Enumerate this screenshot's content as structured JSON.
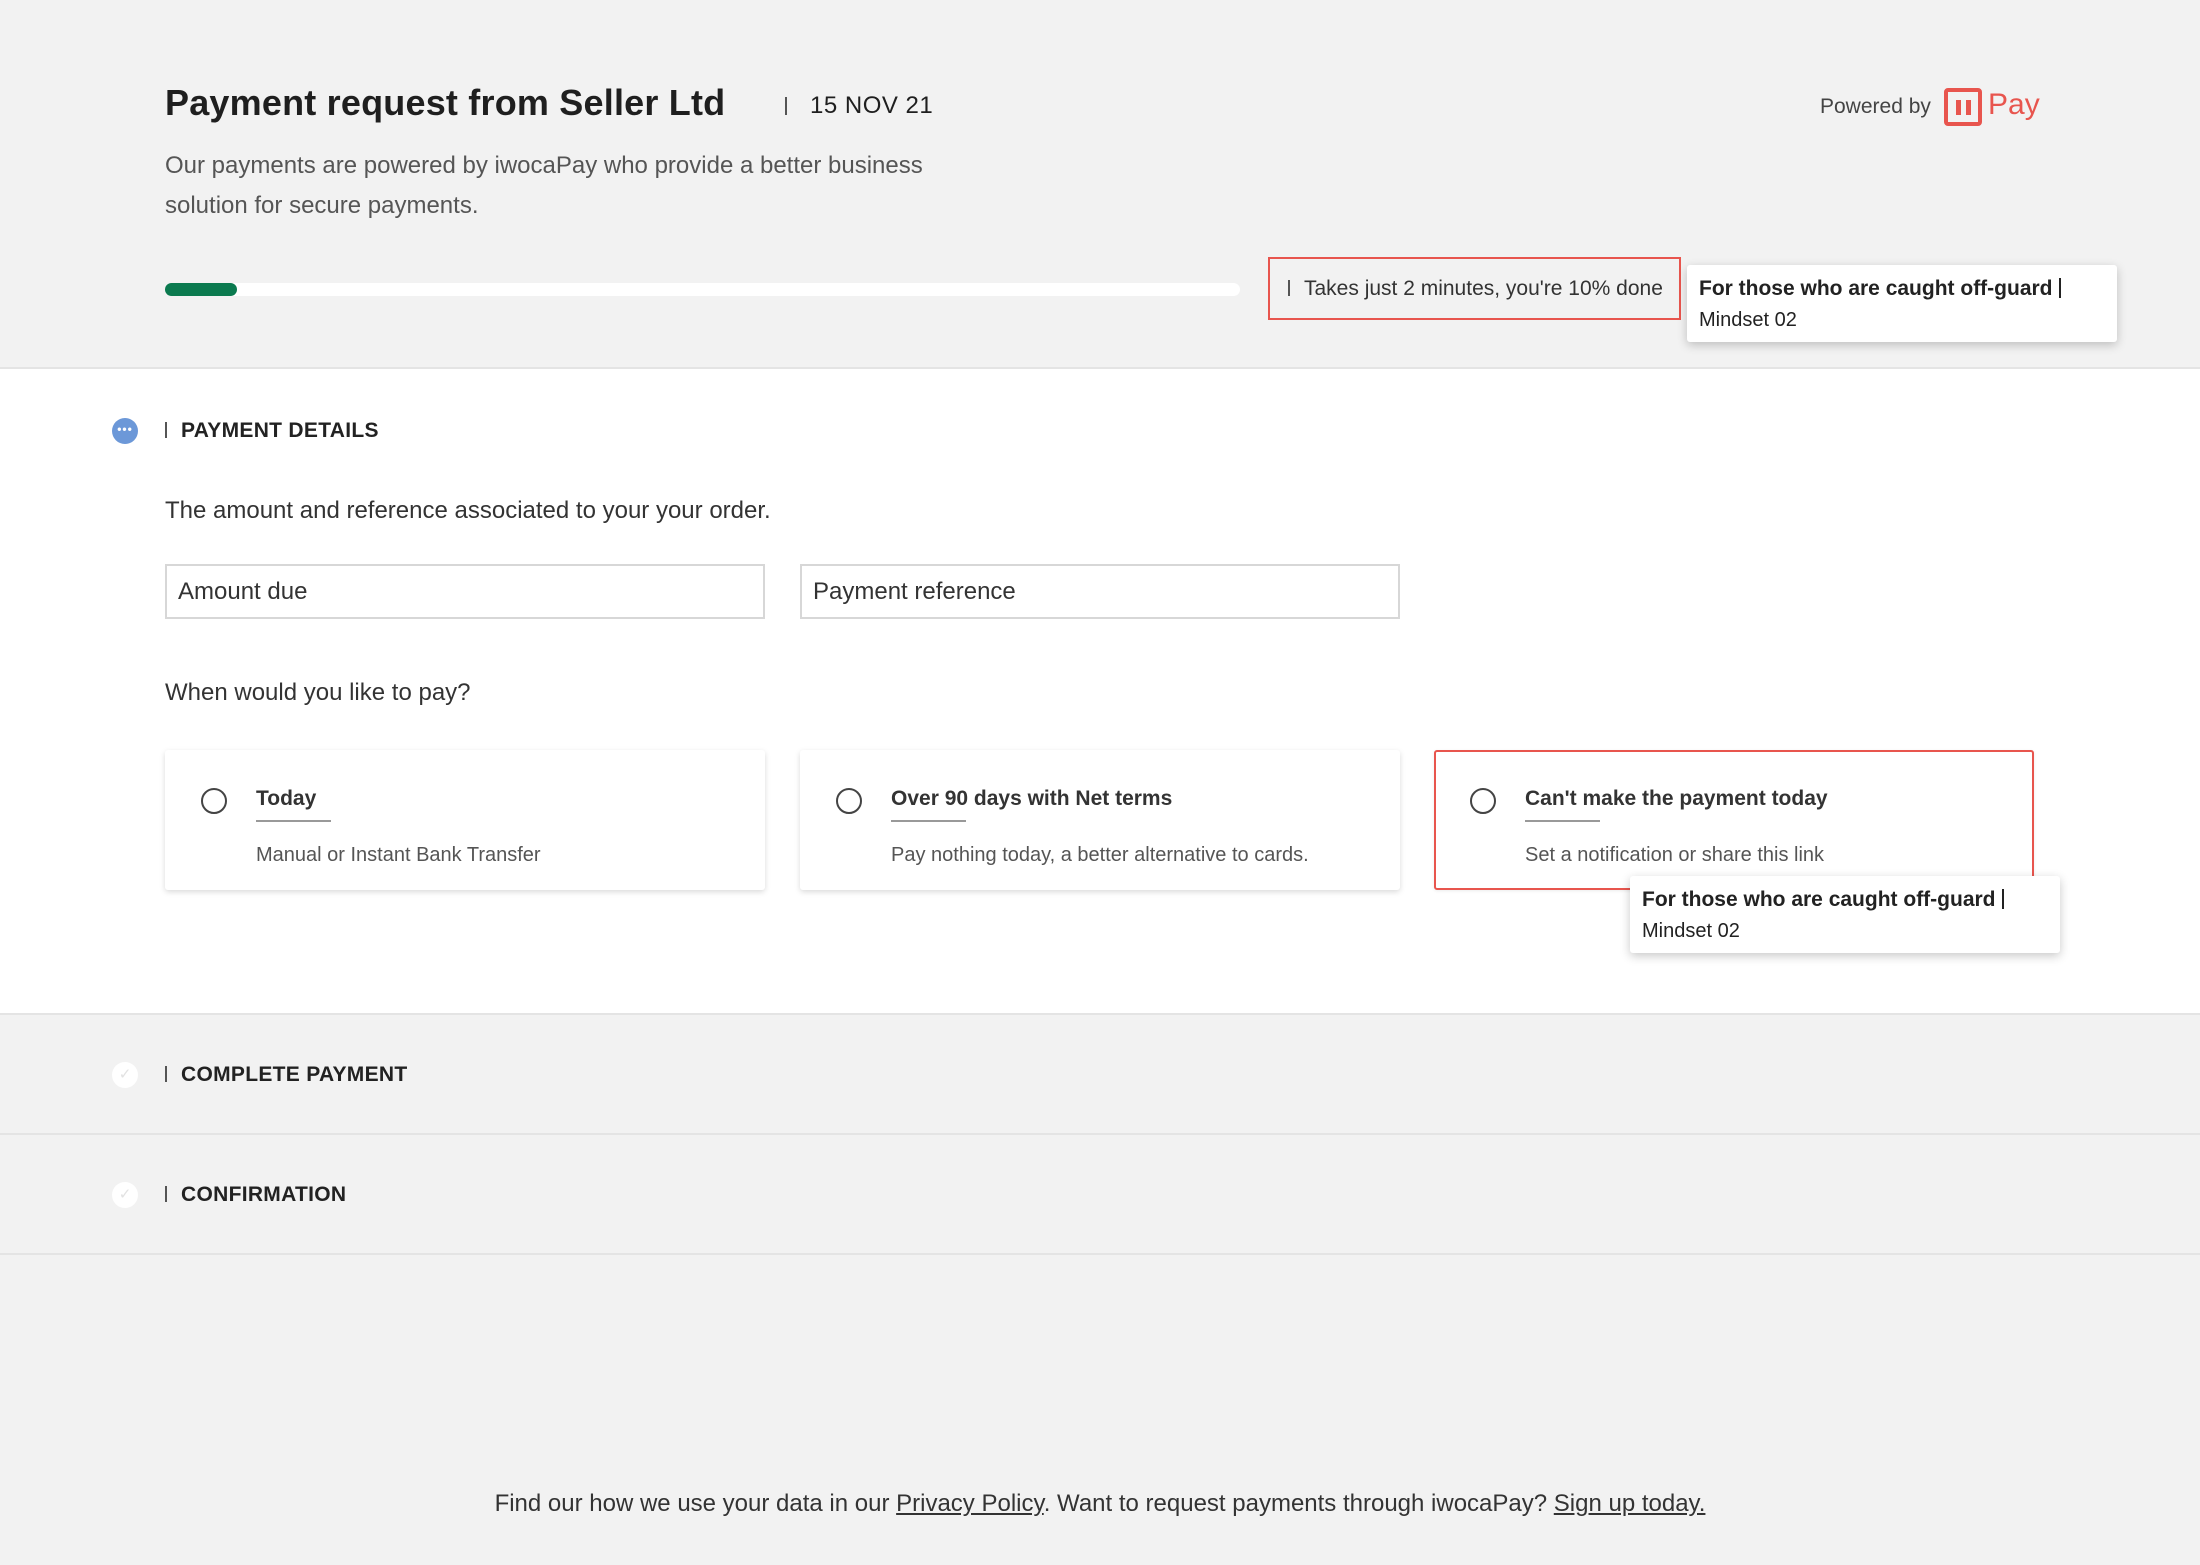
{
  "header": {
    "title": "Payment request from Seller Ltd",
    "date": "15 NOV 21",
    "subtitle": "Our payments are powered by iwocaPay who provide a better business solution for secure payments.",
    "powered_by": "Powered by",
    "brand": "Pay",
    "progress": {
      "percent": 10,
      "note": "Takes just 2 minutes, you're 10% done"
    }
  },
  "tooltips": [
    {
      "title": "For those who are caught off-guard",
      "subtitle": "Mindset 02"
    },
    {
      "title": "For those who are caught off-guard",
      "subtitle": "Mindset 02"
    }
  ],
  "sections": {
    "payment_details": {
      "label": "PAYMENT DETAILS",
      "description": "The amount and reference associated to your your order.",
      "amount_placeholder": "Amount due",
      "reference_placeholder": "Payment reference",
      "question": "When would you like to pay?",
      "options": [
        {
          "title": "Today",
          "subtitle": "Manual or Instant Bank Transfer"
        },
        {
          "title": "Over 90 days with Net terms",
          "subtitle": "Pay nothing today, a better alternative to cards."
        },
        {
          "title": "Can't make the payment today",
          "subtitle": "Set a notification or share this link"
        }
      ]
    },
    "complete_payment": {
      "label": "COMPLETE PAYMENT"
    },
    "confirmation": {
      "label": "CONFIRMATION"
    }
  },
  "footer": {
    "text1": "Find our how we use your data in our ",
    "privacy_link": "Privacy Policy",
    "text2": ".  Want to request payments through iwocaPay? ",
    "signup_link": "Sign up today."
  },
  "colors": {
    "accent": "#e8554e",
    "progress": "#0b7a4f",
    "step_active": "#6c98d8"
  }
}
